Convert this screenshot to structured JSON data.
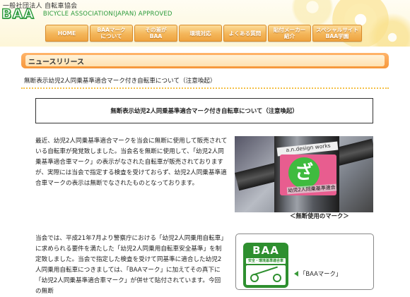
{
  "header": {
    "org_name": "一般社団法人 自転車協会",
    "logo_text": "BAA",
    "logo_subtitle": "BICYCLE ASSOCIATION(JAPAN) APPROVED"
  },
  "nav": {
    "items": [
      {
        "label": "HOME"
      },
      {
        "label": "BAAマーク\nについて"
      },
      {
        "label": "その差が\nBAA"
      },
      {
        "label": "環境対応"
      },
      {
        "label": "よくある質問"
      },
      {
        "label": "貼付メーカー\n紹介"
      },
      {
        "label": "スペシャルサイト\nBAA学園"
      }
    ]
  },
  "section": {
    "title": "ニュースリリース"
  },
  "article": {
    "title": "無断表示幼児2人同乗基準適合マーク付き自転車について（注意喚起）",
    "box_heading": "無断表示幼児2人同乗基準適合マーク付き自転車について（注意喚起）",
    "paragraph1": "最近、幼児2人同乗基準適合マークを当会に無断に使用して販売されている自転車が発覚致しました。当会名を無断に使用して、「幼児2人同乗基準適合車マーク」の表示がなされた自転車が販売されておりますが、実際には当会で指定する検査を受けておらず、幼児2人同乗基準適合車マークの表示は無断でなされたものとなっております。",
    "paragraph2": "当会では、平成21年7月より警察庁における「幼児2人同乗用自転車」に求められる要件を満たした「幼児2人同乗用自転車安全基準」を制定致しました。当会で指定した検査を受けて同基準に適合した幼児2人同乗用自転車につきましては、「BAAマーク」に加えてその真下に「幼児2人同乗基準適合車マーク」が併せて貼付されています。今回の無断",
    "photo_caption": "＜無断使用のマーク＞",
    "photo_sticker_text": "a.n.design works",
    "photo_label_text": "幼児2人同乗基準適合",
    "mark_label": "「BAAマーク」",
    "mark_logo_text": "BAA",
    "mark_logo_band": "安全・環境基準適合車"
  },
  "colors": {
    "nav_orange": "#f4b65a",
    "section_orange": "#f6973b",
    "brand_green": "#2a9a3a",
    "dotline_yellow": "#f4c046"
  }
}
